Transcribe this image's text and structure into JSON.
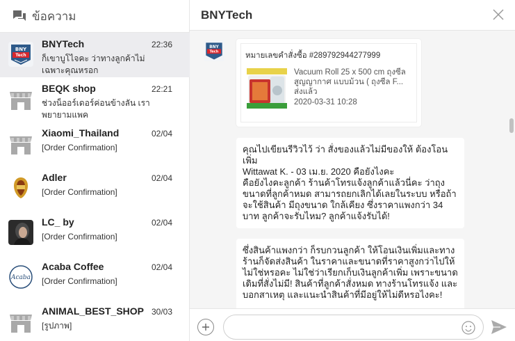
{
  "sidebar": {
    "title": "ข้อความ",
    "conversations": [
      {
        "name": "BNYTech",
        "time": "22:36",
        "preview": "ก็เขาบูโไจคะ ว่าทางลูกค้าไม่เฉพาะคุณหรอก",
        "avatar": "bnytech-logo"
      },
      {
        "name": "BEQK shop",
        "time": "22:21",
        "preview": "ช่วงน็ออร์เดอร์ค่อนข้างลัน เราพยายามแพค",
        "avatar": "shop-placeholder"
      },
      {
        "name": "Xiaomi_Thailand",
        "time": "02/04",
        "preview": "[Order Confirmation]",
        "avatar": "shop-placeholder"
      },
      {
        "name": "Adler",
        "time": "02/04",
        "preview": "[Order Confirmation]",
        "avatar": "adler-logo"
      },
      {
        "name": "LC_ by",
        "time": "02/04",
        "preview": "[Order Confirmation]",
        "avatar": "lc-photo"
      },
      {
        "name": "Acaba Coffee",
        "time": "02/04",
        "preview": "[Order Confirmation]",
        "avatar": "acaba-logo"
      },
      {
        "name": "ANIMAL_BEST_SHOP",
        "time": "30/03",
        "preview": "[รูปภาพ]",
        "avatar": "shop-placeholder"
      }
    ]
  },
  "chat": {
    "title": "BNYTech",
    "avatar_text": "BNY Tech",
    "order": {
      "number": "หมายเลขคำสั่งซื้อ #289792944277999",
      "product": "Vacuum Roll 25 x 500 cm ถุงซีลสูญญากาศ แบบม้วน ( ถุงซีล F...",
      "status": "ส่งแล้ว",
      "date": "2020-03-31 10:28"
    },
    "messages": [
      "คุณไปเขียนรีวิวไว้ ว่า สั่งของแล้วไม่มีของให้ ต้องโอนเพิ่ม\nWittawat K. - 03 เม.ย. 2020  คือยังไงคะ\nคือยังไงคะลูกค้า ร้านค้าโทรแจ้งลูกค้าแล้วนี่คะ ว่าถุงขนาดที่ลูกค้าหมด สามารถยกเลิกได้เลยในระบบ หรือถ้าจะใช้สินค้า มีถุงขนาด ใกล้เคียง ซึ่งราคาแพงกว่า 34 บาท ลูกค้าจะรับไหม? ลูกค้าแจ้งรับได้!",
      "ซึ่งสินค้าแพงกว่า ก็รบกวนลูกค้า ให้โอนเงินเพิ่มและทางร้านก็จัดส่งสินค้า ในราคาและขนาดที่ราคาสูงกว่าไปให้ ไม่ใช่หรอคะ ไม่ใช่ว่าเรียกเก็บเงินลูกค้าเพิ่ม เพราะขนาดเดิมที่สั่งไม่มี! สินค้าที่ลูกค้าสั่งหมด ทางร้านโทรแจ้ง และบอกสาเหตุ และแนะนำสินค้าที่มีอยู่ให้ไม่ดีหรอไงคะ!"
    ],
    "input_value": "",
    "input_placeholder": ""
  },
  "icons": {
    "sidebar": "chat-bubbles-icon",
    "close": "close-icon",
    "add": "plus-icon",
    "emoji": "emoji-icon",
    "send": "send-icon"
  }
}
